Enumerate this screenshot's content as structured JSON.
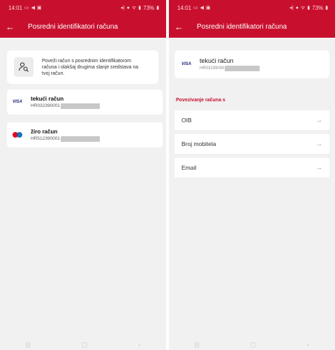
{
  "left": {
    "status": {
      "time": "14:01",
      "battery": "73%"
    },
    "header": {
      "title": "Posredni identifikatori računa"
    },
    "info": {
      "text": "Poveži račun s posrednim identifikatorom računa i olakšaj drugima slanje sredstava na tvoj račun."
    },
    "accounts": [
      {
        "name": "tekući račun",
        "iban": "HR032390001",
        "brand": "VISA"
      },
      {
        "name": "žiro račun",
        "iban": "HR512390001",
        "brand": "mastercard"
      }
    ]
  },
  "right": {
    "status": {
      "time": "14:01",
      "battery": "73%"
    },
    "header": {
      "title": "Posredni identifikatori računa"
    },
    "selected_account": {
      "name": "tekući račun",
      "iban": "HR03239000",
      "brand": "VISA"
    },
    "section_title": "Povezivanje računa s",
    "options": [
      {
        "label": "OIB"
      },
      {
        "label": "Broj mobitela"
      },
      {
        "label": "Email"
      }
    ]
  },
  "icons": {
    "back": "back-arrow-icon",
    "forward": "forward-arrow-icon",
    "info": "person-search-icon"
  }
}
